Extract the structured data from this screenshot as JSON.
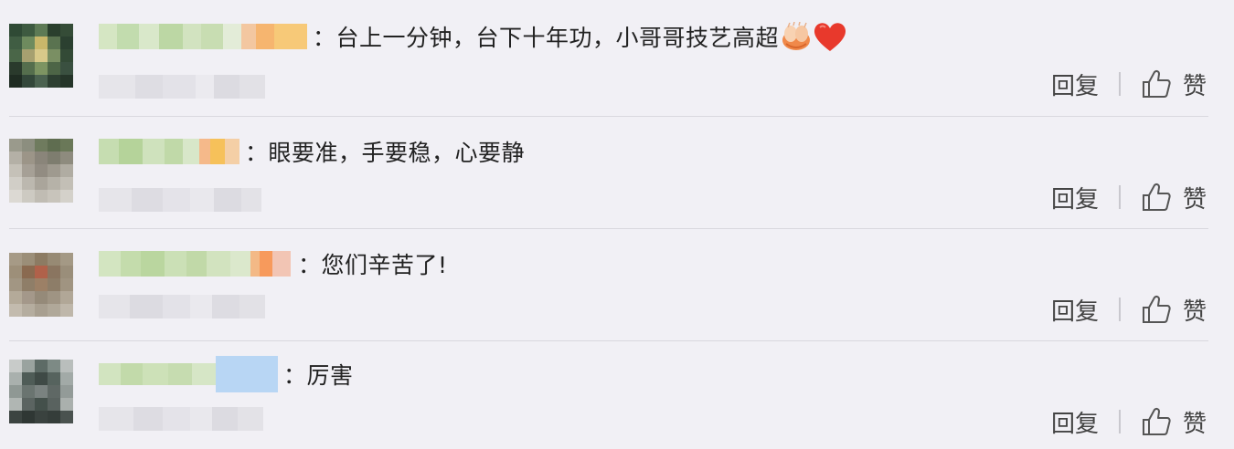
{
  "comments": [
    {
      "separator": "：",
      "text": "台上一分钟，台下十年功，小哥哥技艺高超",
      "emojis": [
        "clapping-hands-icon",
        "red-heart-icon"
      ],
      "reply_label": "回复",
      "like_label": "赞"
    },
    {
      "separator": "：",
      "text": "眼要准，手要稳，心要静",
      "emojis": [],
      "reply_label": "回复",
      "like_label": "赞"
    },
    {
      "separator": "：",
      "text": "您们辛苦了!",
      "emojis": [],
      "reply_label": "回复",
      "like_label": "赞"
    },
    {
      "separator": "：",
      "text": "厉害",
      "emojis": [],
      "reply_label": "回复",
      "like_label": "赞"
    }
  ],
  "colors": {
    "background": "#f1f0f5",
    "divider": "#d9d8de",
    "text": "#222222",
    "action_text": "#444444",
    "heart": "#e8392c"
  }
}
